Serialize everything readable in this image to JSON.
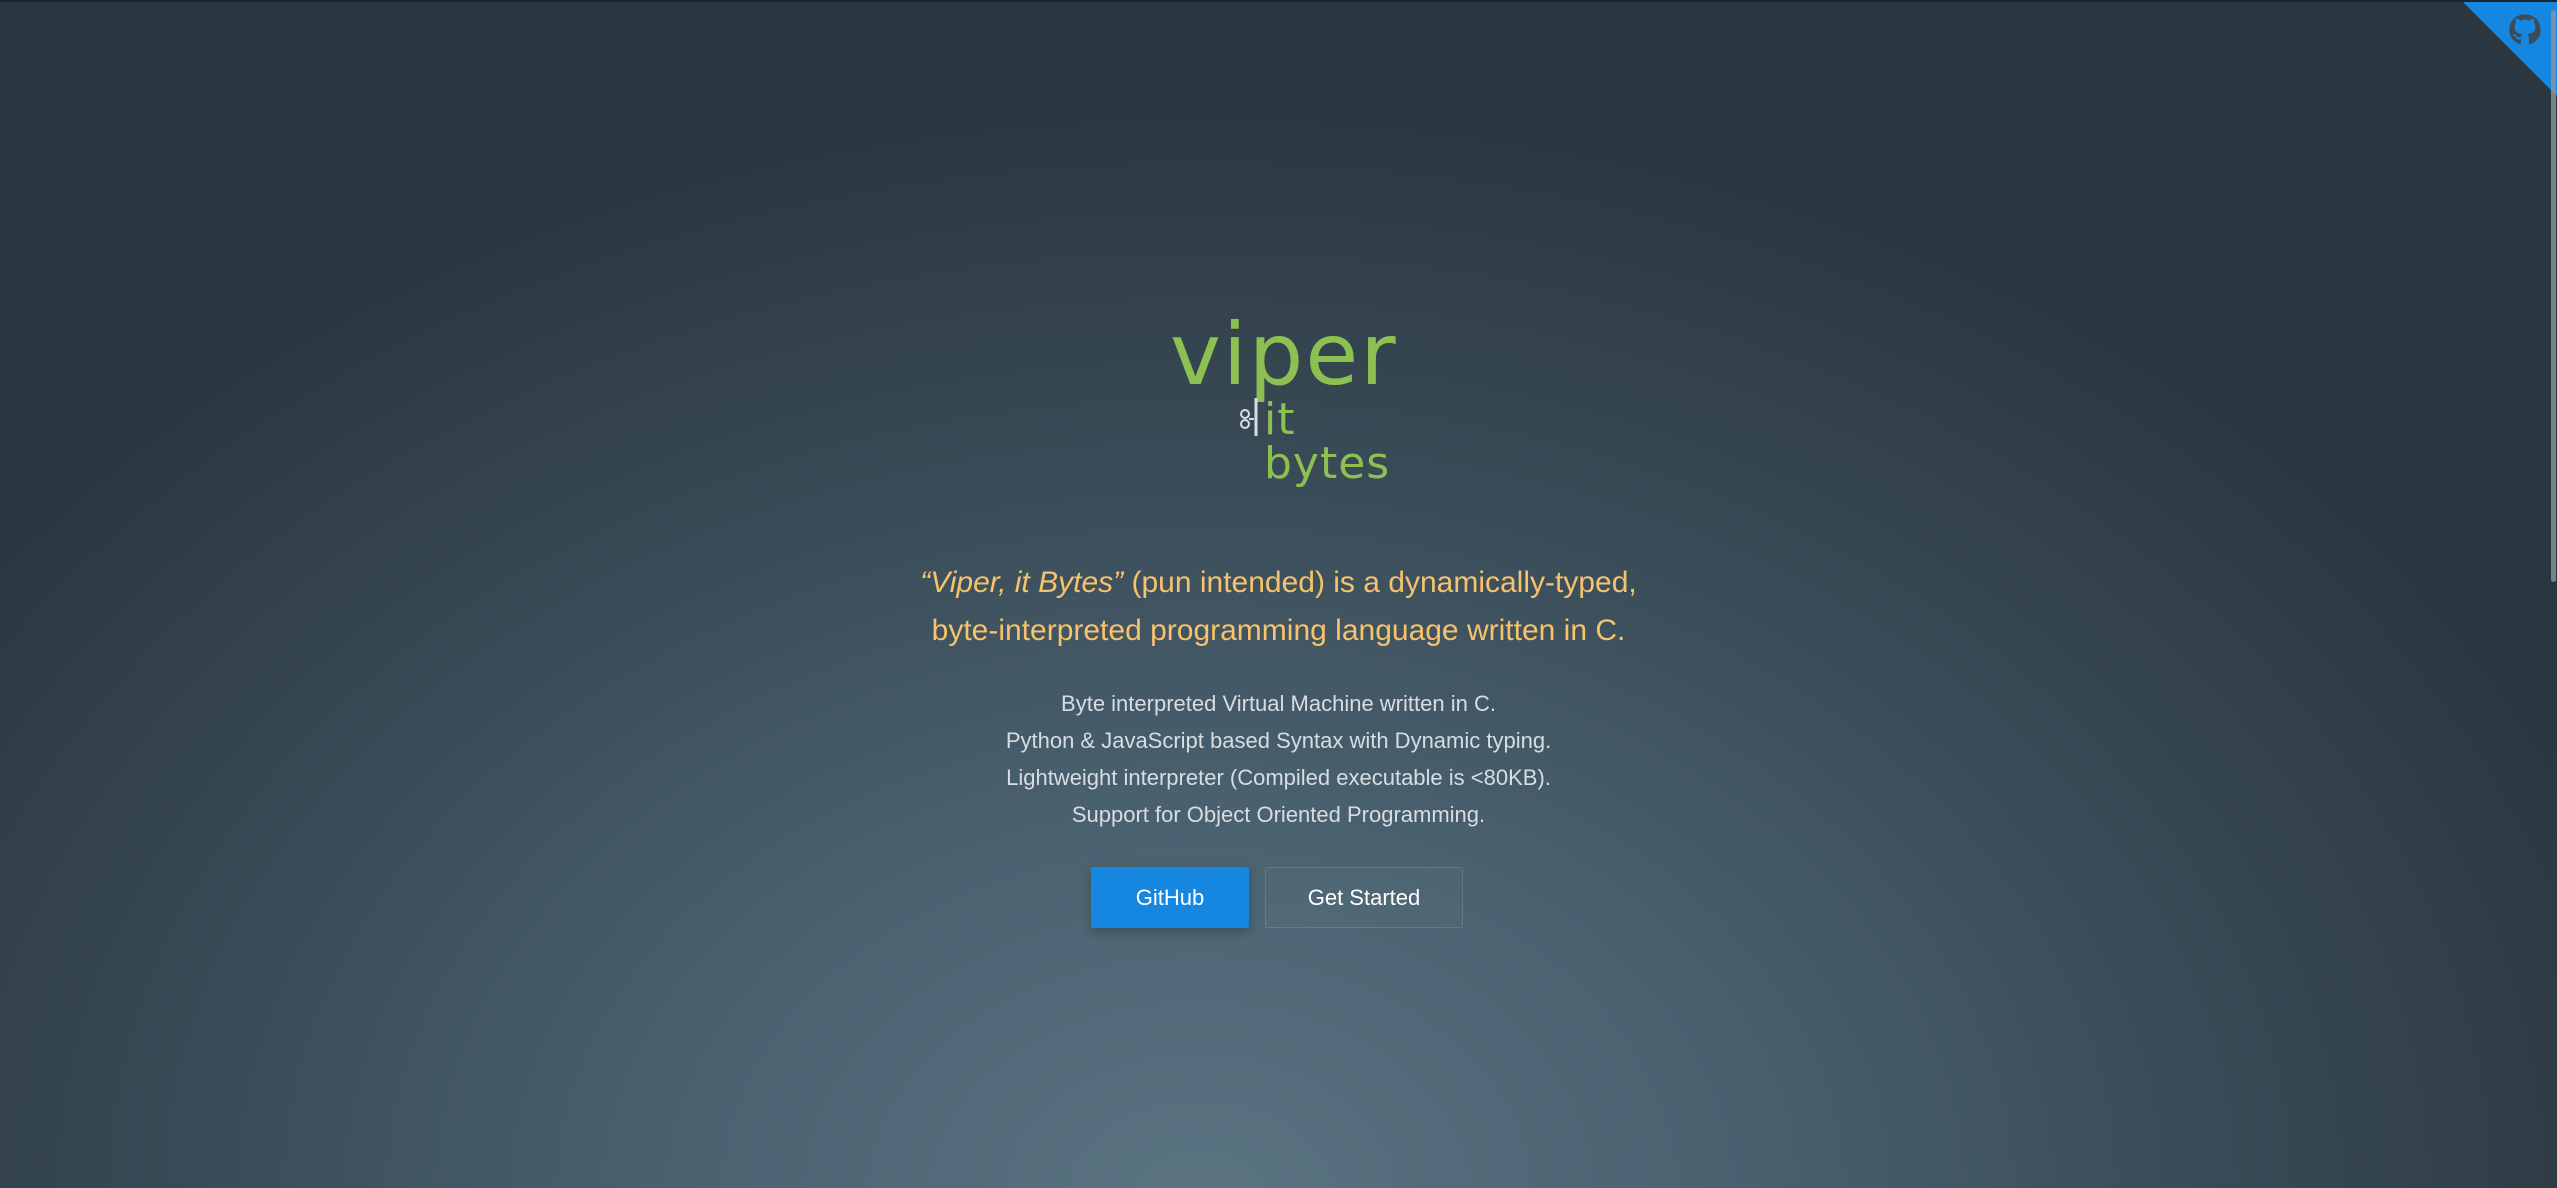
{
  "corner": {
    "icon": "github-octocat-icon",
    "color": "#1587e0"
  },
  "logo": {
    "word": "viper",
    "subtitle": "it bytes",
    "color": "#8cc152",
    "icon": "snake-icon"
  },
  "tagline": {
    "quote": "“Viper, it Bytes”",
    "line1_rest": " (pun intended) is a dynamically-typed,",
    "line2": "byte-interpreted programming language written in C.",
    "color": "#f6c26b"
  },
  "features": [
    "Byte interpreted Virtual Machine written in C.",
    "Python & JavaScript based Syntax with Dynamic typing.",
    "Lightweight interpreter (Compiled executable is <80KB).",
    "Support for Object Oriented Programming."
  ],
  "buttons": {
    "github": "GitHub",
    "get_started": "Get Started",
    "accent": "#1587e0"
  }
}
